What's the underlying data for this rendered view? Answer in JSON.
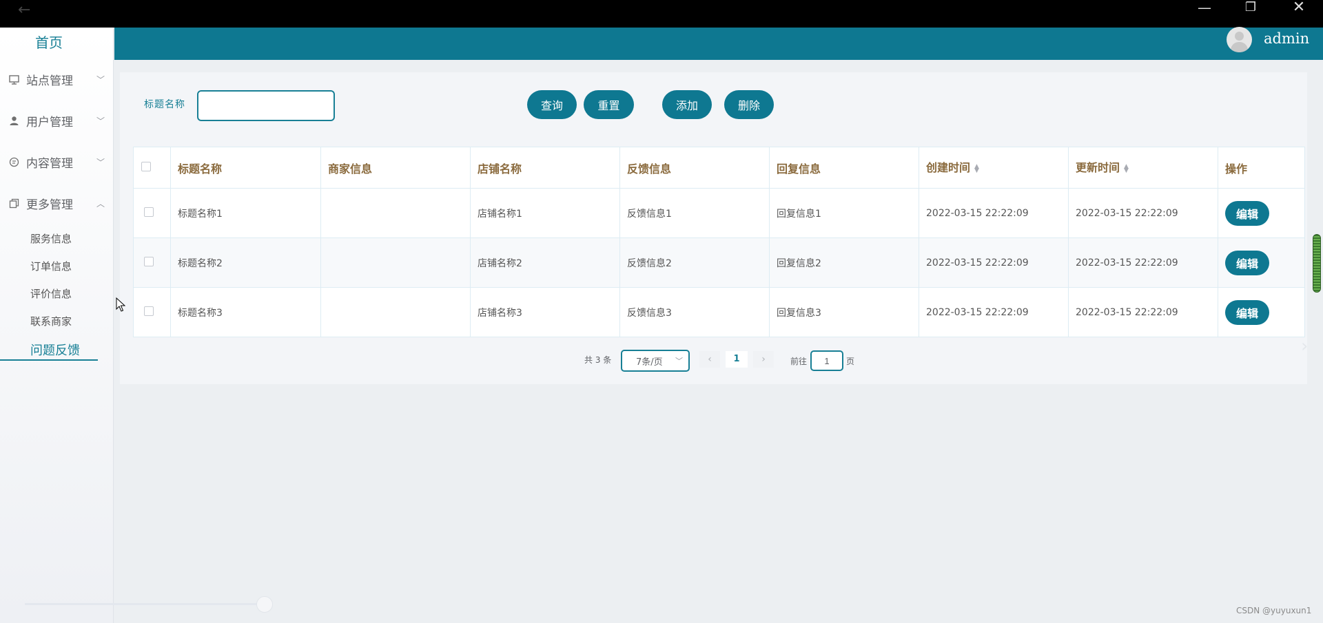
{
  "sidebar": {
    "home": "首页",
    "menus": [
      {
        "label": "站点管理",
        "icon": "monitor-icon",
        "expanded": false
      },
      {
        "label": "用户管理",
        "icon": "user-icon",
        "expanded": false
      },
      {
        "label": "内容管理",
        "icon": "chat-icon",
        "expanded": false
      },
      {
        "label": "更多管理",
        "icon": "copy-icon",
        "expanded": true
      }
    ],
    "submenu": [
      "服务信息",
      "订单信息",
      "评价信息",
      "联系商家",
      "问题反馈"
    ],
    "active_submenu": "问题反馈"
  },
  "header": {
    "username": "admin",
    "avatar_icon": "user-avatar-icon",
    "color": "#0e7891"
  },
  "search": {
    "label": "标题名称",
    "value": "",
    "buttons": {
      "query": "查询",
      "reset": "重置",
      "add": "添加",
      "delete": "删除"
    }
  },
  "table": {
    "columns": [
      "标题名称",
      "商家信息",
      "店铺名称",
      "反馈信息",
      "回复信息",
      "创建时间",
      "更新时间",
      "操作"
    ],
    "rows": [
      {
        "title": "标题名称1",
        "merchant": "",
        "shop": "店铺名称1",
        "feedback": "反馈信息1",
        "reply": "回复信息1",
        "created": "2022-03-15 22:22:09",
        "updated": "2022-03-15 22:22:09",
        "action": "编辑"
      },
      {
        "title": "标题名称2",
        "merchant": "",
        "shop": "店铺名称2",
        "feedback": "反馈信息2",
        "reply": "回复信息2",
        "created": "2022-03-15 22:22:09",
        "updated": "2022-03-15 22:22:09",
        "action": "编辑"
      },
      {
        "title": "标题名称3",
        "merchant": "",
        "shop": "店铺名称3",
        "feedback": "反馈信息3",
        "reply": "回复信息3",
        "created": "2022-03-15 22:22:09",
        "updated": "2022-03-15 22:22:09",
        "action": "编辑"
      }
    ]
  },
  "pagination": {
    "total": "共 3 条",
    "page_size": "7条/页",
    "current_page": "1",
    "goto_label": "前往",
    "goto_value": "1",
    "page_unit": "页"
  },
  "watermark": "CSDN @yuyuxun1",
  "accent_color": "#177f95"
}
